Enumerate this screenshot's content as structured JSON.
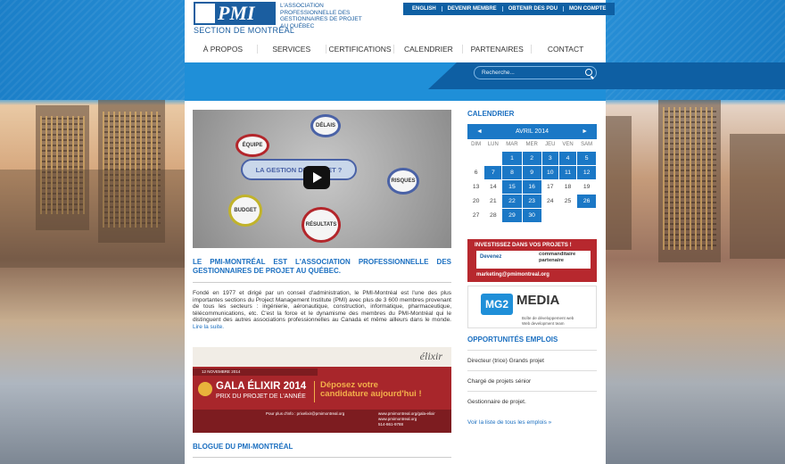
{
  "header": {
    "logo_text": "PMI",
    "section_label": "SECTION DE MONTRÉAL",
    "association": "L'ASSOCIATION PROFESSIONNELLE DES GESTIONNAIRES DE PROJET AU QUÉBEC",
    "top_links": [
      "ENGLISH",
      "DEVENIR MEMBRE",
      "OBTENIR DES PDU",
      "MON COMPTE"
    ],
    "nav": [
      "À PROPOS",
      "SERVICES",
      "CERTIFICATIONS",
      "CALENDRIER",
      "PARTENAIRES",
      "CONTACT"
    ],
    "search_placeholder": "Recherche..."
  },
  "video": {
    "center": "LA GESTION DE PROJET ?",
    "bubbles": [
      "ÉQUIPE",
      "DÉLAIS",
      "RISQUES",
      "RÉSULTATS",
      "BUDGET"
    ]
  },
  "intro": {
    "title": "LE PMI-MONTRÉAL EST L'ASSOCIATION PROFESSIONNELLE DES GESTIONNAIRES DE PROJET AU QUÉBEC.",
    "body": "Fondé en 1977 et dirigé par un conseil d'administration, le PMI-Montréal est l'une des plus importantes sections du Project Management Institute (PMI) avec plus de 3 600 membres provenant de tous les secteurs : ingénierie, aéronautique, construction, informatique, pharmaceutique, télécommunications, etc. C'est la force et le dynamisme des membres du PMI-Montréal qui le distinguent des autres associations professionnelles au Canada et même ailleurs dans le monde.",
    "more": "Lire la suite."
  },
  "gala": {
    "elixir": "élixir",
    "date": "12 NOVEMBRE 2014",
    "name": "GALA ÉLIXIR 2014",
    "sub": "PRIX DU PROJET DE L'ANNÉE",
    "cta1": "Déposez votre",
    "cta2": "candidature aujourd'hui !",
    "contact": "Pour plus d'info : prixelixir@pmimontreal.org",
    "link1": "www.pmimontreal.org/gala-elixir",
    "link2": "www.pmimontreal.org",
    "phone": "514-861-9788"
  },
  "blog": {
    "title": "BLOGUE DU PMI-MONTRÉAL"
  },
  "calendar": {
    "title": "CALENDRIER",
    "month": "AVRIL 2014",
    "prev": "◄",
    "next": "►",
    "days": [
      "DIM",
      "LUN",
      "MAR",
      "MER",
      "JEU",
      "VEN",
      "SAM"
    ],
    "weeks": [
      [
        "",
        "",
        "1",
        "2",
        "3",
        "4",
        "5"
      ],
      [
        "6",
        "7",
        "8",
        "9",
        "10",
        "11",
        "12"
      ],
      [
        "13",
        "14",
        "15",
        "16",
        "17",
        "18",
        "19"
      ],
      [
        "20",
        "21",
        "22",
        "23",
        "24",
        "25",
        "26"
      ],
      [
        "27",
        "28",
        "29",
        "30",
        "",
        "",
        ""
      ]
    ],
    "highlighted": [
      "1",
      "2",
      "3",
      "4",
      "5",
      "7",
      "8",
      "9",
      "10",
      "11",
      "12",
      "15",
      "16",
      "22",
      "23",
      "26",
      "29",
      "30"
    ]
  },
  "banner1": {
    "title": "INVESTISSEZ DANS VOS PROJETS !",
    "become": "Devenez",
    "role": "commanditaire partenaire",
    "email": "marketing@pmimontreal.org"
  },
  "banner2": {
    "logo": "MG2",
    "name": "MEDIA",
    "sub1": "Boîte de développement web",
    "sub2": "Web development team"
  },
  "jobs": {
    "title": "OPPORTUNITÉS EMPLOIS",
    "items": [
      "Directeur (trice) Grands projet",
      "Chargé de projets sénior",
      "Gestionnaire de projet."
    ],
    "all": "Voir la liste de tous les emplois »"
  }
}
